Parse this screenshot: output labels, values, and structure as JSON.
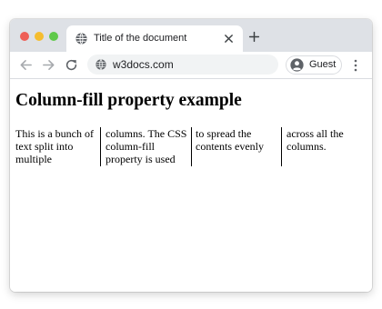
{
  "window": {
    "controls": {
      "close_color": "#ee5f57",
      "minimize_color": "#f5bd2f",
      "maximize_color": "#5fc94a"
    }
  },
  "tab": {
    "title": "Title of the document",
    "favicon": "globe-icon",
    "close_icon": "close-icon"
  },
  "new_tab_icon": "plus-icon",
  "toolbar": {
    "back_icon": "arrow-left-icon",
    "forward_icon": "arrow-right-icon",
    "reload_icon": "reload-icon",
    "url": "w3docs.com",
    "site_icon": "globe-icon",
    "profile_name": "Guest",
    "profile_icon": "avatar-icon",
    "menu_icon": "kebab-menu-icon"
  },
  "page": {
    "heading": "Column-fill property example",
    "columns": [
      "This is a bunch of text split into multiple",
      "columns. The CSS column-fill property is used",
      "to spread the contents evenly",
      "across all the columns."
    ]
  }
}
